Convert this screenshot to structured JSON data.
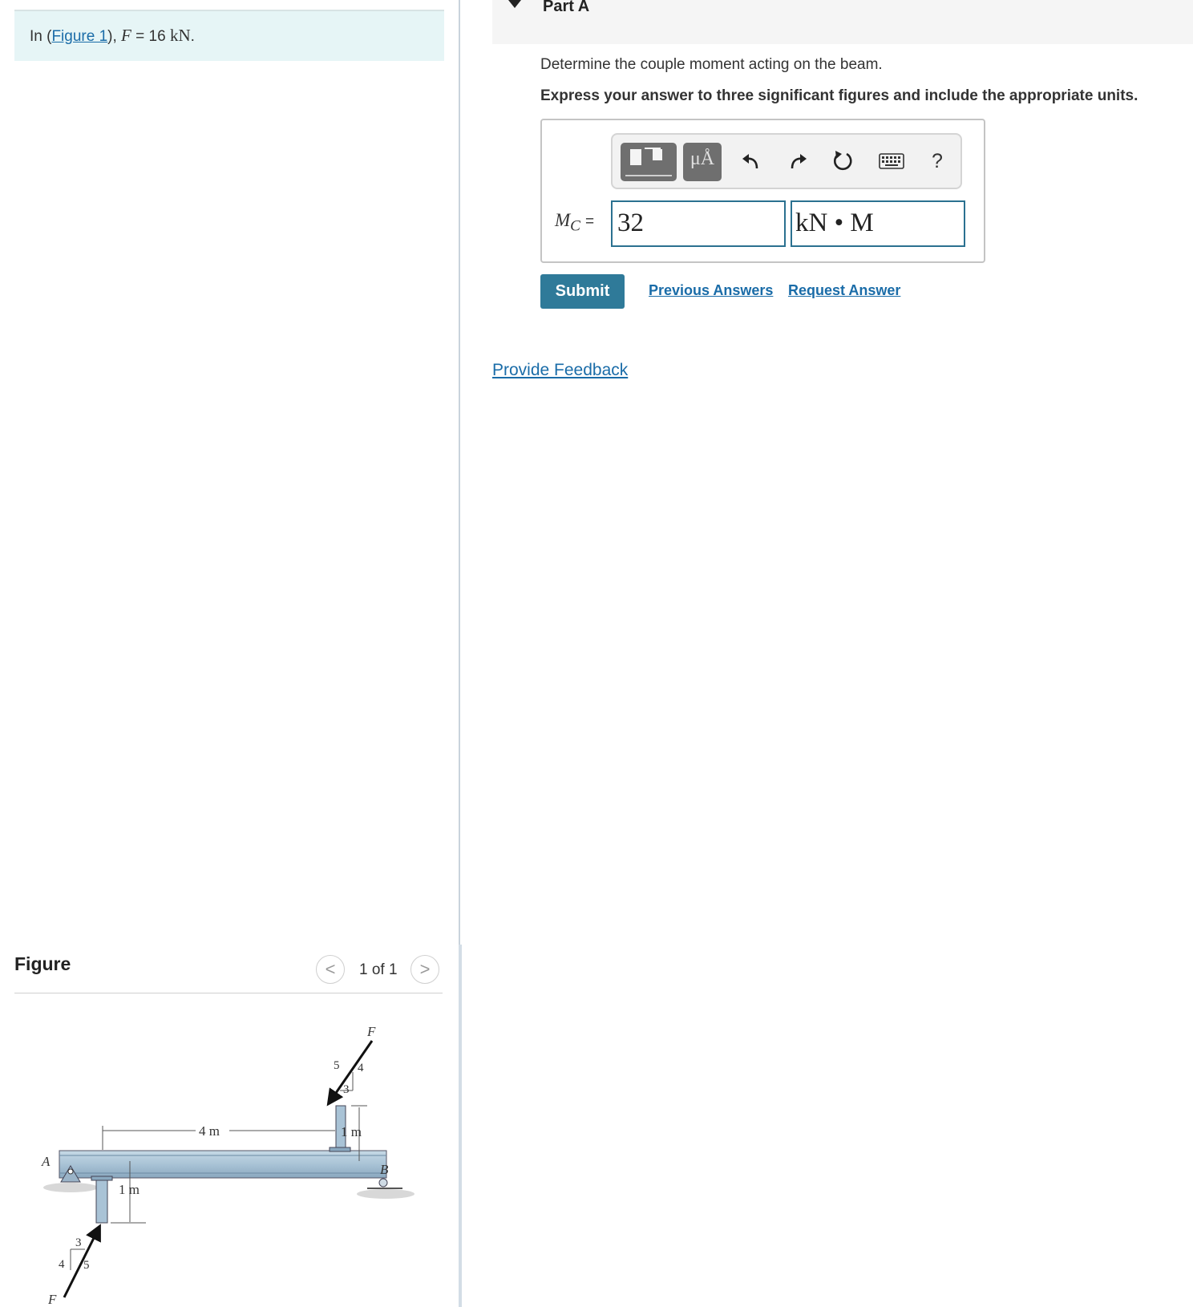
{
  "intro": {
    "prefix": "In (",
    "figure_link": "Figure 1",
    "suffix": "), ",
    "var": "F",
    "equals": " = 16 ",
    "unit": "kN",
    "period": "."
  },
  "figure_panel": {
    "title": "Figure",
    "pager_text": "1 of 1",
    "prev": "<",
    "next": ">",
    "diagram_labels": {
      "point_a": "A",
      "point_b": "B",
      "dim_span": "4 m",
      "dim_top": "1 m",
      "dim_bottom": "1 m",
      "force_top": "F",
      "force_bottom": "F",
      "tri_top_hyp": "5",
      "tri_top_vert": "4",
      "tri_top_horz": "3",
      "tri_bot_horz": "3",
      "tri_bot_vert": "4",
      "tri_bot_hyp": "5"
    }
  },
  "part": {
    "title": "Part A",
    "question": "Determine the couple moment acting on the beam.",
    "instruction": "Express your answer to three significant figures and include the appropriate units."
  },
  "answer": {
    "label_var": "M",
    "label_sub": "C",
    "label_eq": "=",
    "value": "32",
    "unit": "kN • M",
    "toolbar": {
      "units_label": "μÅ",
      "help_label": "?"
    }
  },
  "actions": {
    "submit": "Submit",
    "previous_answers": "Previous Answers",
    "request_answer": "Request Answer",
    "feedback": "Provide Feedback"
  },
  "colors": {
    "link": "#1a6ca8",
    "submit_bg": "#2f7a99",
    "intro_bg": "#e6f5f6",
    "beam": "#a9c3d6"
  }
}
